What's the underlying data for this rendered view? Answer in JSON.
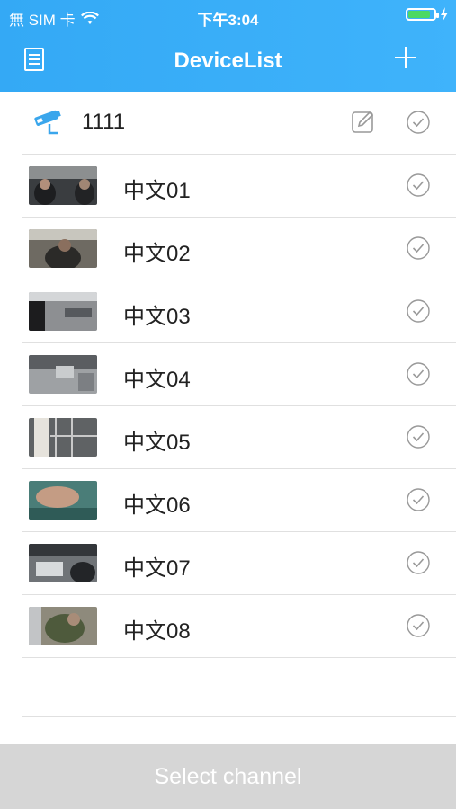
{
  "status": {
    "carrier": "無 SIM 卡",
    "time": "下午3:04"
  },
  "nav": {
    "title": "DeviceList"
  },
  "device": {
    "name": "1111"
  },
  "channels": [
    {
      "name": "中文01"
    },
    {
      "name": "中文02"
    },
    {
      "name": "中文03"
    },
    {
      "name": "中文04"
    },
    {
      "name": "中文05"
    },
    {
      "name": "中文06"
    },
    {
      "name": "中文07"
    },
    {
      "name": "中文08"
    }
  ],
  "footer": {
    "button_label": "Select channel"
  },
  "colors": {
    "accent": "#3fb3fb",
    "footer_bg": "#d6d6d6",
    "battery": "#4cd964"
  }
}
